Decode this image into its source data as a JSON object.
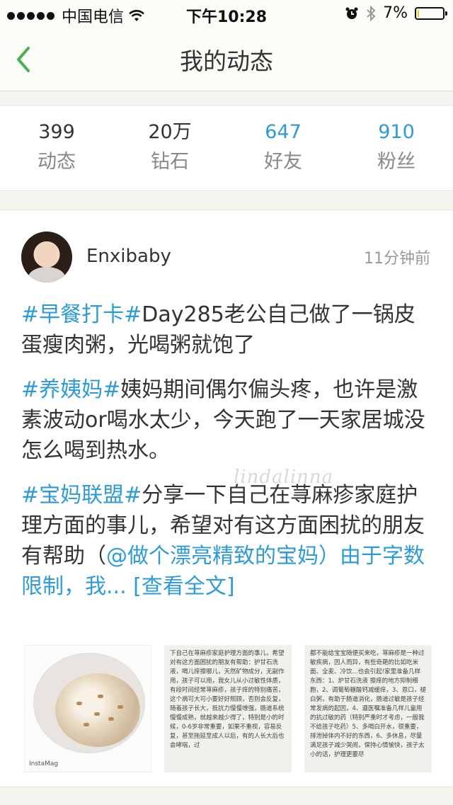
{
  "status_bar": {
    "carrier": "中国电信",
    "time": "下午10:28",
    "battery": "7%",
    "battery_level": 0.07
  },
  "nav": {
    "title": "我的动态",
    "back_icon": "chevron-left-icon"
  },
  "stats": [
    {
      "value": "399",
      "label": "动态"
    },
    {
      "value": "20万",
      "label": "钻石"
    },
    {
      "value": "647",
      "label": "好友"
    },
    {
      "value": "910",
      "label": "粉丝"
    }
  ],
  "colors": {
    "accent_blue": "#2e9bd6",
    "back_green": "#4caf50",
    "battery_yellow": "#f5c518"
  },
  "post": {
    "username": "Enxibaby",
    "time": "11分钟前",
    "p1_tag": "#早餐打卡#",
    "p1_text": "Day285老公自己做了一锅皮蛋瘦肉粥，光喝粥就饱了",
    "p2_tag": "#养姨妈#",
    "p2_text": "姨妈期间偶尔偏头疼，也许是激素波动or喝水太少，今天跑了一天家居城没怎么喝到热水。",
    "p3_tag": "#宝妈联盟#",
    "p3_text": "分享一下自己在荨麻疹家庭护理方面的事儿，希望对有这方面困扰的朋友有帮助（",
    "p3_mention": "@做个漂亮精致的宝妈",
    "p3_text2": "）由于字数限制，我... ",
    "more_link": "[查看全文]",
    "watermark": "lindalinna",
    "images": {
      "img1_caption": "InstaMag",
      "img2_text": "下自己在荨麻疹家庭护理方面的事儿，希望对有这方面困扰的朋友有帮助：护甘石洗液，喝儿痒擦哪儿，天然矿物成分，无副作用，孩子可以用，我女儿从小过敏性体质，有段时间经常荨麻疹，孩子痒的特别痛苦，这个病可大可小要好好照顾，否则会反复，随着孩子长大，抵抗力慢慢增强，肠道系统慢慢成熟，就越来越少得了，特别是小的时候，0-6岁非常重要，如果不重视，容易反复，甚至拖延至成人以后，有的人长大后也会哮喘，过",
      "img3_text": "都不能给宝宝随便买来吃，荨麻疹是一种过敏疾病，因人而异，有些奇葩的比如吃米面、全麦、冷饮...也会引起!家里准备几样东西：1、炉甘石洗液 擦痒的地方抑制细胞，2、调葡萄糖酸钙减缓痒，3、恩口，褪白粥，有助于肠道消化，肠道过敏是孩子经常发病的起因，4、遵医嘱准备几样儿童用的抗过敏的药（特别严重时才考虑，一般我不给孩子吃药）5、多喝白开水，很重要，排泄掉体内不好的东西，6、多休息，尽量满足孩子减少哭闹，保持心情愉快，孩子太小的话，护理更要尽"
    }
  }
}
